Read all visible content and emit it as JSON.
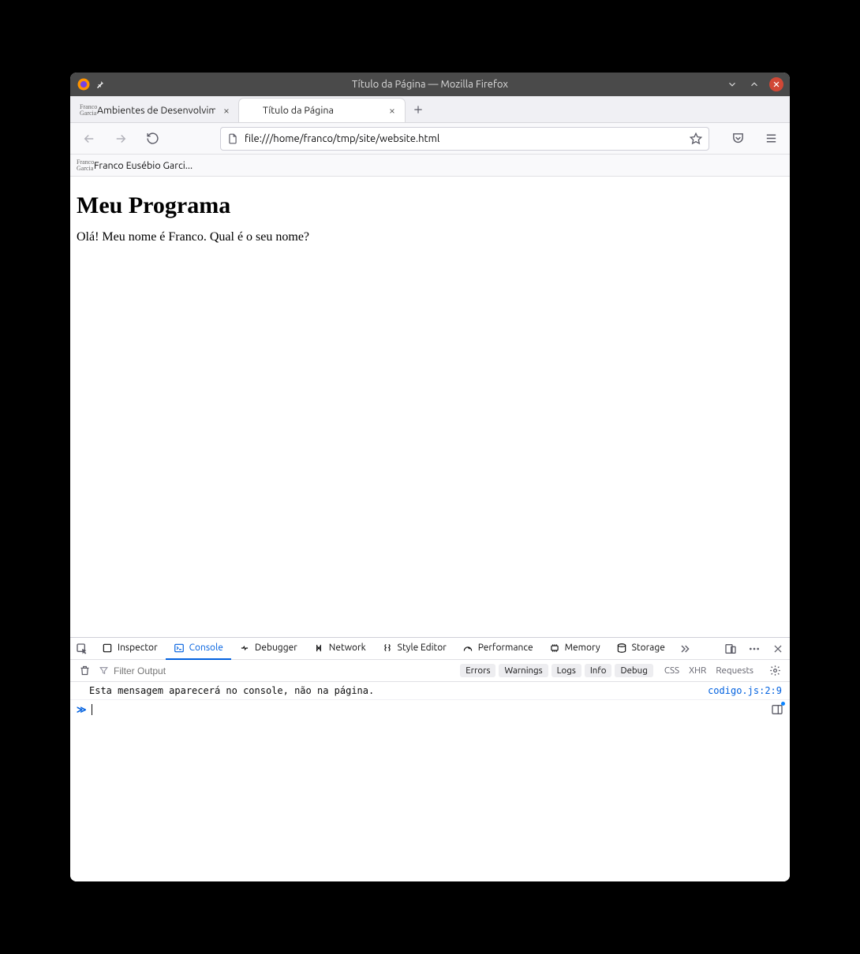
{
  "window": {
    "title": "Título da Página — Mozilla Firefox"
  },
  "tabs": {
    "items": [
      {
        "favicon1": "Franco",
        "favicon2": "Garcia",
        "label": "Ambientes de Desenvolvimen"
      },
      {
        "favicon1": "",
        "favicon2": "",
        "label": "Título da Página"
      }
    ],
    "newtab_tooltip": "+"
  },
  "navbar": {
    "url": "file:///home/franco/tmp/site/website.html"
  },
  "bookmarks": {
    "items": [
      {
        "favicon1": "Franco",
        "favicon2": "Garcia",
        "label": "Franco Eusébio Garci..."
      }
    ]
  },
  "page": {
    "heading": "Meu Programa",
    "paragraph": "Olá! Meu nome é Franco. Qual é o seu nome?"
  },
  "devtools": {
    "tabs": {
      "inspector": "Inspector",
      "console": "Console",
      "debugger": "Debugger",
      "network": "Network",
      "styleeditor": "Style Editor",
      "performance": "Performance",
      "memory": "Memory",
      "storage": "Storage"
    },
    "toolbar": {
      "filter_placeholder": "Filter Output",
      "pills": {
        "errors": "Errors",
        "warnings": "Warnings",
        "logs": "Logs",
        "info": "Info",
        "debug": "Debug"
      },
      "links": {
        "css": "CSS",
        "xhr": "XHR",
        "requests": "Requests"
      }
    },
    "console": {
      "message": "Esta mensagem aparecerá no console, não na página.",
      "source": "codigo.js:2:9"
    }
  }
}
